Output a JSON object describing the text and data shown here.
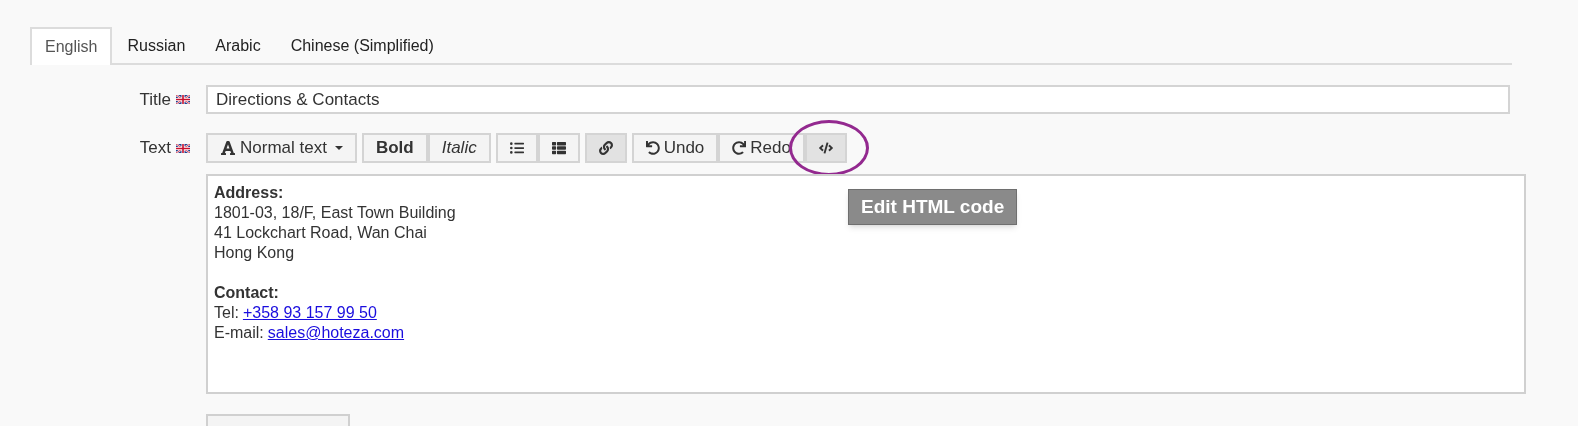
{
  "tabs": [
    {
      "label": "English",
      "selected": true
    },
    {
      "label": "Russian",
      "selected": false
    },
    {
      "label": "Arabic",
      "selected": false
    },
    {
      "label": "Chinese (Simplified)",
      "selected": false
    }
  ],
  "title_field": {
    "label": "Title",
    "value": "Directions & Contacts"
  },
  "text_field": {
    "label": "Text"
  },
  "toolbar": [
    [
      {
        "kind": "format",
        "label": "Normal text",
        "active": false
      }
    ],
    [
      {
        "kind": "bold",
        "label": "Bold",
        "active": false
      },
      {
        "kind": "italic",
        "label": "Italic",
        "active": false
      }
    ],
    [
      {
        "kind": "bullets",
        "active": false
      },
      {
        "kind": "numbered",
        "active": false
      }
    ],
    [
      {
        "kind": "link",
        "active": true
      }
    ],
    [
      {
        "kind": "undo",
        "label": "Undo",
        "active": false
      },
      {
        "kind": "redo",
        "label": "Redo",
        "active": false
      },
      {
        "kind": "code",
        "active": true,
        "highlighted": true
      }
    ]
  ],
  "tooltip": "Edit HTML code",
  "content": [
    {
      "kind": "heading",
      "text": "Address:"
    },
    {
      "kind": "text",
      "text": "1801-03, 18/F, East Town Building"
    },
    {
      "kind": "text",
      "text": "41 Lockchart Road, Wan Chai"
    },
    {
      "kind": "text",
      "text": "Hong Kong"
    },
    {
      "kind": "blank"
    },
    {
      "kind": "heading",
      "text": "Contact:"
    },
    {
      "kind": "link",
      "label": "Tel:",
      "link": "+358 93 157 99 50"
    },
    {
      "kind": "link",
      "label": "E-mail:",
      "link": "sales@hoteza.com"
    }
  ]
}
